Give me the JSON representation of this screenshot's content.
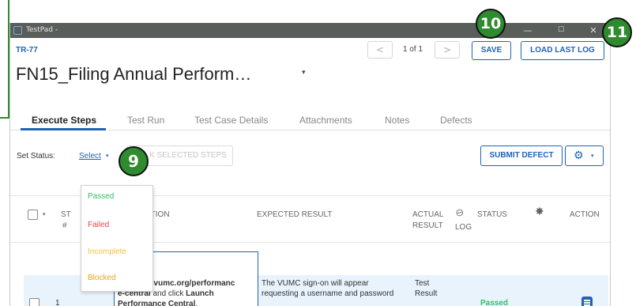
{
  "window": {
    "title": "TestPad -",
    "minimize_glyph": "—",
    "maximize_glyph": "☐",
    "close_glyph": "✕"
  },
  "header": {
    "test_run_id": "TR-77",
    "page_indicator": "1 of 1",
    "prev_glyph": "<",
    "next_glyph": ">",
    "save_label": "SAVE",
    "load_last_log_label": "LOAD LAST LOG",
    "title": "FN15_Filing Annual Perform…",
    "title_caret": "▾"
  },
  "tabs": [
    {
      "label": "Execute Steps",
      "active": true
    },
    {
      "label": "Test Run",
      "active": false
    },
    {
      "label": "Test Case Details",
      "active": false
    },
    {
      "label": "Attachments",
      "active": false
    },
    {
      "label": "Notes",
      "active": false
    },
    {
      "label": "Defects",
      "active": false
    }
  ],
  "toolbar": {
    "set_status_label": "Set Status:",
    "select_label": "Select",
    "select_caret": "▾",
    "mark_selected_label": "K SELECTED STEPS",
    "submit_defect_label": "SUBMIT DEFECT",
    "gear_glyph": "⚙",
    "gear_caret": "▾"
  },
  "status_dropdown": {
    "options": [
      {
        "label": "Passed",
        "color": "#35c06a"
      },
      {
        "label": "Failed",
        "color": "#e8434b"
      },
      {
        "label": "Incomplete",
        "color": "#f2c23a"
      },
      {
        "label": "Blocked",
        "color": "#e8a417"
      }
    ]
  },
  "table": {
    "headers": {
      "step_line1": "ST",
      "step_line2": "#",
      "description": "PTION",
      "expected": "EXPECTED RESULT",
      "actual_line1": "ACTUAL",
      "actual_line2": "RESULT",
      "log": "LOG",
      "status": "STATUS",
      "action": "ACTION"
    },
    "rows": [
      {
        "step": "1",
        "description_line1": "https://hr.vumc.org/performanc",
        "description_line2_bold": "e-central",
        "description_line2_rest": " and click ",
        "description_line2_bold2": "Launch",
        "description_line3_bold": "Performance Central",
        "description_line3_rest": ".",
        "expected_line1": "The VUMC sign-on will appear",
        "expected_line2": "requesting a username and password",
        "actual_line1": "Test",
        "actual_line2": "Result",
        "status": "Passed"
      }
    ]
  },
  "callouts": {
    "nine": "9",
    "ten": "10",
    "eleven": "11"
  },
  "colors": {
    "accent": "#1e64b4",
    "callout_green": "#2e8b2e",
    "passed": "#35c06a",
    "failed": "#e8434b",
    "incomplete": "#f2c23a",
    "blocked": "#e8a417",
    "titlebar": "#5a5e5a",
    "row_highlight": "#e8f3fb"
  }
}
